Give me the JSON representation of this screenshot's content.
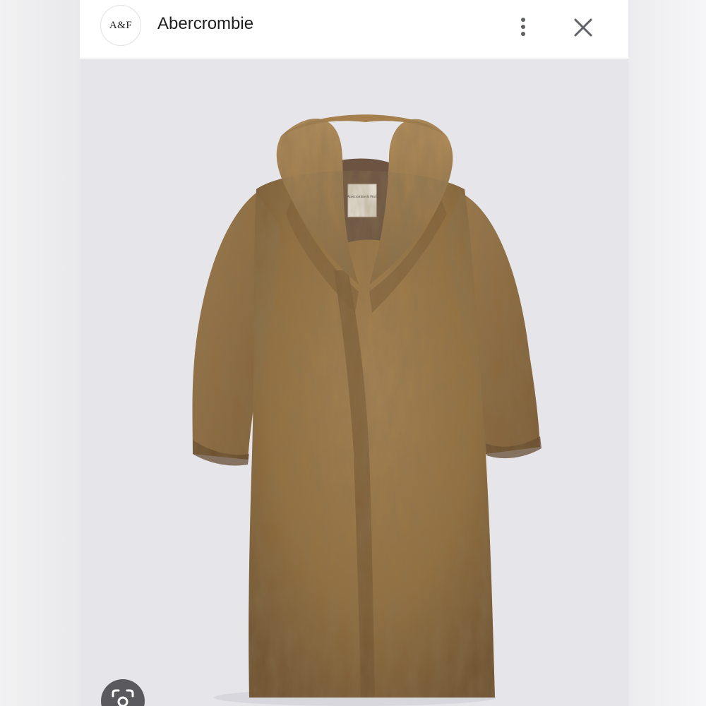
{
  "header": {
    "logo_text": "A&F",
    "title": "Abercrombie",
    "more_icon": "more-vert-icon",
    "close_icon": "close-icon"
  },
  "image": {
    "label_text": "Abercrombie & Fitch"
  },
  "lens_icon": "lens-camera-icon",
  "colors": {
    "fur_main": "#9a7649",
    "fur_dark": "#5e4426",
    "fur_light": "#c9a572",
    "panel_bg": "#e6e5ea"
  }
}
